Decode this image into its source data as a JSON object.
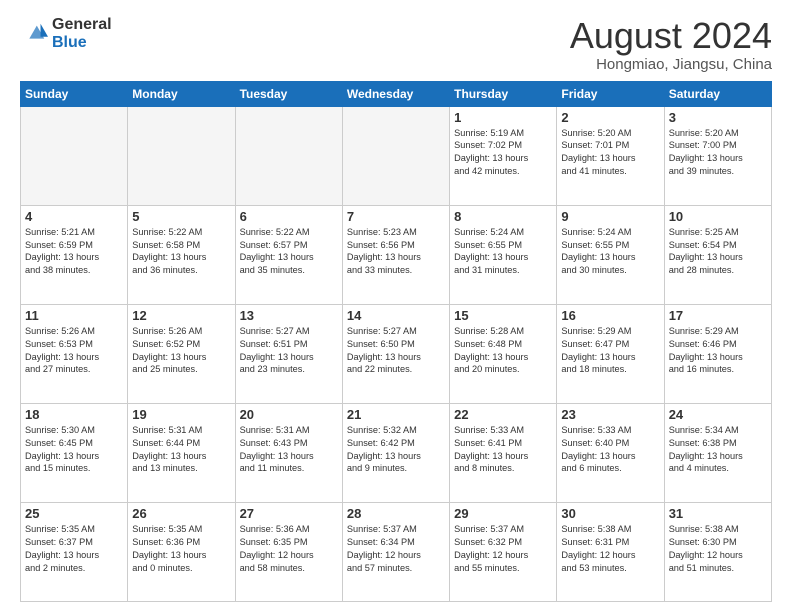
{
  "header": {
    "logo_line1": "General",
    "logo_line2": "Blue",
    "month": "August 2024",
    "location": "Hongmiao, Jiangsu, China"
  },
  "weekdays": [
    "Sunday",
    "Monday",
    "Tuesday",
    "Wednesday",
    "Thursday",
    "Friday",
    "Saturday"
  ],
  "weeks": [
    [
      {
        "day": "",
        "info": ""
      },
      {
        "day": "",
        "info": ""
      },
      {
        "day": "",
        "info": ""
      },
      {
        "day": "",
        "info": ""
      },
      {
        "day": "1",
        "info": "Sunrise: 5:19 AM\nSunset: 7:02 PM\nDaylight: 13 hours\nand 42 minutes."
      },
      {
        "day": "2",
        "info": "Sunrise: 5:20 AM\nSunset: 7:01 PM\nDaylight: 13 hours\nand 41 minutes."
      },
      {
        "day": "3",
        "info": "Sunrise: 5:20 AM\nSunset: 7:00 PM\nDaylight: 13 hours\nand 39 minutes."
      }
    ],
    [
      {
        "day": "4",
        "info": "Sunrise: 5:21 AM\nSunset: 6:59 PM\nDaylight: 13 hours\nand 38 minutes."
      },
      {
        "day": "5",
        "info": "Sunrise: 5:22 AM\nSunset: 6:58 PM\nDaylight: 13 hours\nand 36 minutes."
      },
      {
        "day": "6",
        "info": "Sunrise: 5:22 AM\nSunset: 6:57 PM\nDaylight: 13 hours\nand 35 minutes."
      },
      {
        "day": "7",
        "info": "Sunrise: 5:23 AM\nSunset: 6:56 PM\nDaylight: 13 hours\nand 33 minutes."
      },
      {
        "day": "8",
        "info": "Sunrise: 5:24 AM\nSunset: 6:55 PM\nDaylight: 13 hours\nand 31 minutes."
      },
      {
        "day": "9",
        "info": "Sunrise: 5:24 AM\nSunset: 6:55 PM\nDaylight: 13 hours\nand 30 minutes."
      },
      {
        "day": "10",
        "info": "Sunrise: 5:25 AM\nSunset: 6:54 PM\nDaylight: 13 hours\nand 28 minutes."
      }
    ],
    [
      {
        "day": "11",
        "info": "Sunrise: 5:26 AM\nSunset: 6:53 PM\nDaylight: 13 hours\nand 27 minutes."
      },
      {
        "day": "12",
        "info": "Sunrise: 5:26 AM\nSunset: 6:52 PM\nDaylight: 13 hours\nand 25 minutes."
      },
      {
        "day": "13",
        "info": "Sunrise: 5:27 AM\nSunset: 6:51 PM\nDaylight: 13 hours\nand 23 minutes."
      },
      {
        "day": "14",
        "info": "Sunrise: 5:27 AM\nSunset: 6:50 PM\nDaylight: 13 hours\nand 22 minutes."
      },
      {
        "day": "15",
        "info": "Sunrise: 5:28 AM\nSunset: 6:48 PM\nDaylight: 13 hours\nand 20 minutes."
      },
      {
        "day": "16",
        "info": "Sunrise: 5:29 AM\nSunset: 6:47 PM\nDaylight: 13 hours\nand 18 minutes."
      },
      {
        "day": "17",
        "info": "Sunrise: 5:29 AM\nSunset: 6:46 PM\nDaylight: 13 hours\nand 16 minutes."
      }
    ],
    [
      {
        "day": "18",
        "info": "Sunrise: 5:30 AM\nSunset: 6:45 PM\nDaylight: 13 hours\nand 15 minutes."
      },
      {
        "day": "19",
        "info": "Sunrise: 5:31 AM\nSunset: 6:44 PM\nDaylight: 13 hours\nand 13 minutes."
      },
      {
        "day": "20",
        "info": "Sunrise: 5:31 AM\nSunset: 6:43 PM\nDaylight: 13 hours\nand 11 minutes."
      },
      {
        "day": "21",
        "info": "Sunrise: 5:32 AM\nSunset: 6:42 PM\nDaylight: 13 hours\nand 9 minutes."
      },
      {
        "day": "22",
        "info": "Sunrise: 5:33 AM\nSunset: 6:41 PM\nDaylight: 13 hours\nand 8 minutes."
      },
      {
        "day": "23",
        "info": "Sunrise: 5:33 AM\nSunset: 6:40 PM\nDaylight: 13 hours\nand 6 minutes."
      },
      {
        "day": "24",
        "info": "Sunrise: 5:34 AM\nSunset: 6:38 PM\nDaylight: 13 hours\nand 4 minutes."
      }
    ],
    [
      {
        "day": "25",
        "info": "Sunrise: 5:35 AM\nSunset: 6:37 PM\nDaylight: 13 hours\nand 2 minutes."
      },
      {
        "day": "26",
        "info": "Sunrise: 5:35 AM\nSunset: 6:36 PM\nDaylight: 13 hours\nand 0 minutes."
      },
      {
        "day": "27",
        "info": "Sunrise: 5:36 AM\nSunset: 6:35 PM\nDaylight: 12 hours\nand 58 minutes."
      },
      {
        "day": "28",
        "info": "Sunrise: 5:37 AM\nSunset: 6:34 PM\nDaylight: 12 hours\nand 57 minutes."
      },
      {
        "day": "29",
        "info": "Sunrise: 5:37 AM\nSunset: 6:32 PM\nDaylight: 12 hours\nand 55 minutes."
      },
      {
        "day": "30",
        "info": "Sunrise: 5:38 AM\nSunset: 6:31 PM\nDaylight: 12 hours\nand 53 minutes."
      },
      {
        "day": "31",
        "info": "Sunrise: 5:38 AM\nSunset: 6:30 PM\nDaylight: 12 hours\nand 51 minutes."
      }
    ]
  ]
}
